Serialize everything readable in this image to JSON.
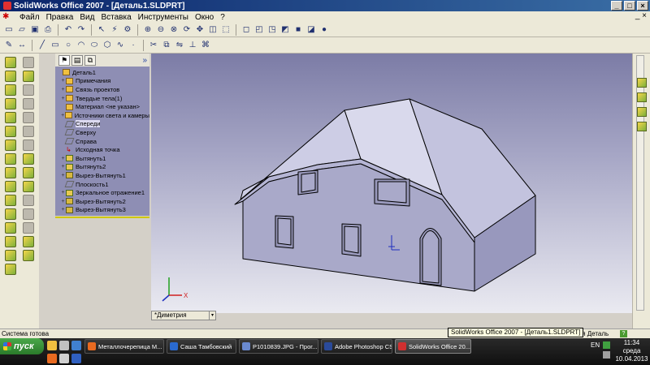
{
  "window": {
    "title": "SolidWorks Office 2007 - [Деталь1.SLDPRT]",
    "buttons": [
      "_",
      "□",
      "×"
    ]
  },
  "menu": {
    "items": [
      "Файл",
      "Правка",
      "Вид",
      "Вставка",
      "Инструменты",
      "Окно",
      "?"
    ],
    "close_doc": "_ ×"
  },
  "feature_manager": {
    "expand_glyph": "»",
    "tree": [
      {
        "label": "Деталь1",
        "level": 0,
        "toggle": "",
        "icon": "part-icon"
      },
      {
        "label": "Примечания",
        "level": 1,
        "toggle": "+",
        "icon": "annotations-icon"
      },
      {
        "label": "Связь проектов",
        "level": 1,
        "toggle": "+",
        "icon": "design-binder-icon"
      },
      {
        "label": "Твердые тела(1)",
        "level": 1,
        "toggle": "+",
        "icon": "solid-bodies-icon"
      },
      {
        "label": "Материал <не указан>",
        "level": 1,
        "toggle": "",
        "icon": "material-icon"
      },
      {
        "label": "Источники света и камеры",
        "level": 1,
        "toggle": "+",
        "icon": "lights-icon"
      },
      {
        "label": "Спереди",
        "level": 1,
        "toggle": "",
        "icon": "plane-icon",
        "selected": true
      },
      {
        "label": "Сверху",
        "level": 1,
        "toggle": "",
        "icon": "plane-icon"
      },
      {
        "label": "Справа",
        "level": 1,
        "toggle": "",
        "icon": "plane-icon"
      },
      {
        "label": "Исходная точка",
        "level": 1,
        "toggle": "",
        "icon": "origin-icon"
      },
      {
        "label": "Вытянуть1",
        "level": 1,
        "toggle": "+",
        "icon": "extrude-icon"
      },
      {
        "label": "Вытянуть2",
        "level": 1,
        "toggle": "+",
        "icon": "extrude-icon"
      },
      {
        "label": "Вырез-Вытянуть1",
        "level": 1,
        "toggle": "+",
        "icon": "cut-extrude-icon"
      },
      {
        "label": "Плоскость1",
        "level": 1,
        "toggle": "",
        "icon": "plane-icon"
      },
      {
        "label": "Зеркальное отражение1",
        "level": 1,
        "toggle": "+",
        "icon": "mirror-icon"
      },
      {
        "label": "Вырез-Вытянуть2",
        "level": 1,
        "toggle": "+",
        "icon": "cut-extrude-icon"
      },
      {
        "label": "Вырез-Вытянуть3",
        "level": 1,
        "toggle": "+",
        "icon": "cut-extrude-icon"
      }
    ]
  },
  "viewport": {
    "view_name": "*Диметрия",
    "dropdown_glyph": "▾",
    "model": "house-with-mansard-roof",
    "axis_label": "X",
    "colors": {
      "bg_top": "#7c7ca6",
      "bg_bottom": "#eaeaf1",
      "wall": "#a9a9c9",
      "roof": "#cdcde4",
      "edge": "#000000"
    }
  },
  "status": {
    "left": "Система готова",
    "right": "актируется Деталь",
    "help": "?",
    "tooltip": "SolidWorks Office 2007 - [Деталь1.SLDPRT]"
  },
  "taskbar": {
    "start_label": "пуск",
    "tasks": [
      {
        "label": "Металлочерепица М...",
        "color": "#e86a20"
      },
      {
        "label": "Саша Тамбовский",
        "color": "#2a6ad0"
      },
      {
        "label": "P1010839.JPG - Прог...",
        "color": "#6a8ad0"
      },
      {
        "label": "Adobe Photoshop CS...",
        "color": "#2a4a9a"
      },
      {
        "label": "SolidWorks Office 20...",
        "color": "#d03030",
        "active": true
      }
    ],
    "language": "EN",
    "time": "11:34",
    "day": "среда",
    "date": "10.04.2013"
  }
}
